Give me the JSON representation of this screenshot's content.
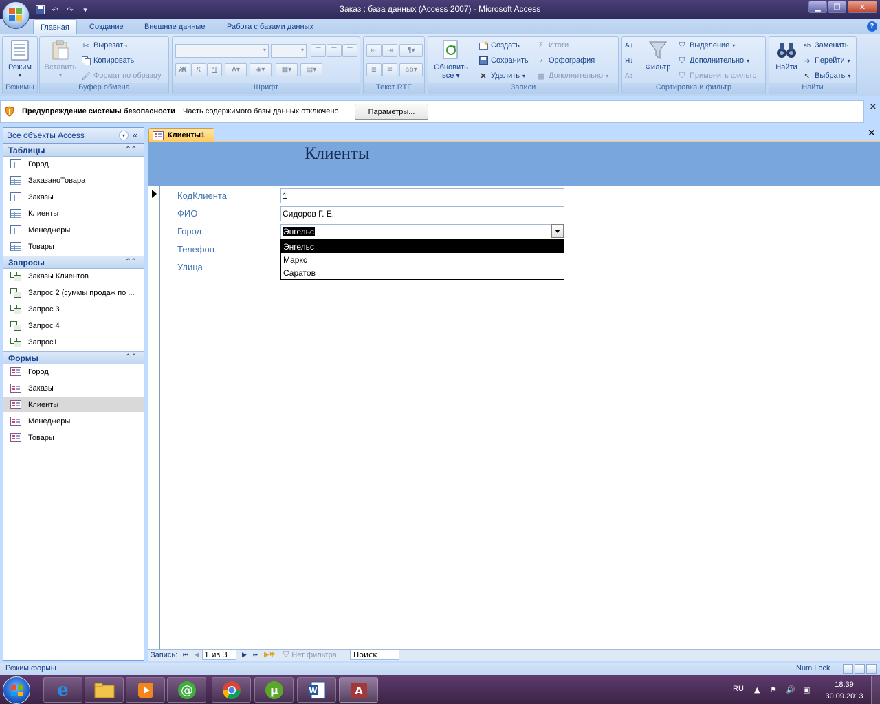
{
  "window": {
    "title": "Заказ : база данных (Access 2007)  -  Microsoft Access"
  },
  "ribbon_tabs": [
    "Главная",
    "Создание",
    "Внешние данные",
    "Работа с базами данных"
  ],
  "groups": {
    "modes": {
      "label": "Режимы",
      "view": "Режим"
    },
    "clipboard": {
      "label": "Буфер обмена",
      "paste": "Вставить",
      "cut": "Вырезать",
      "copy": "Копировать",
      "format_painter": "Формат по образцу"
    },
    "font": {
      "label": "Шрифт"
    },
    "rtf": {
      "label": "Текст RTF"
    },
    "records": {
      "label": "Записи",
      "refresh": "Обновить",
      "refresh2": "все",
      "new": "Создать",
      "save": "Сохранить",
      "delete": "Удалить",
      "totals": "Итоги",
      "spelling": "Орфография",
      "more": "Дополнительно"
    },
    "sort": {
      "label": "Сортировка и фильтр",
      "filter": "Фильтр",
      "selection": "Выделение",
      "advanced": "Дополнительно",
      "toggle": "Применить фильтр"
    },
    "find": {
      "label": "Найти",
      "find": "Найти",
      "replace": "Заменить",
      "goto": "Перейти",
      "select": "Выбрать"
    }
  },
  "security": {
    "title": "Предупреждение системы безопасности",
    "message": "Часть содержимого базы данных отключено",
    "button": "Параметры..."
  },
  "nav": {
    "header": "Все объекты Access",
    "sections": [
      {
        "title": "Таблицы",
        "items": [
          "Город",
          "ЗаказаноТовара",
          "Заказы",
          "Клиенты",
          "Менеджеры",
          "Товары"
        ]
      },
      {
        "title": "Запросы",
        "items": [
          "Заказы Клиентов",
          "Запрос 2 (суммы продаж по ...",
          "Запрос 3",
          "Запрос 4",
          "Запрос1"
        ]
      },
      {
        "title": "Формы",
        "items": [
          "Город",
          "Заказы",
          "Клиенты",
          "Менеджеры",
          "Товары"
        ]
      }
    ],
    "selected": "Клиенты"
  },
  "document": {
    "tab": "Клиенты1",
    "form_title": "Клиенты",
    "fields": [
      {
        "label": "КодКлиента",
        "value": "1"
      },
      {
        "label": "ФИО",
        "value": "Сидоров Г. Е."
      },
      {
        "label": "Город",
        "value": "Энгельс"
      },
      {
        "label": "Телефон",
        "value": ""
      },
      {
        "label": "Улица",
        "value": ""
      }
    ],
    "dropdown_options": [
      "Энгельс",
      "Маркс",
      "Саратов"
    ],
    "dropdown_highlighted": "Энгельс"
  },
  "record_nav": {
    "label": "Запись:",
    "position": "1 из 3",
    "filter": "Нет фильтра",
    "search": "Поиск"
  },
  "status": {
    "mode": "Режим формы",
    "numlock": "Num Lock"
  },
  "taskbar": {
    "lang": "RU",
    "time": "18:39",
    "date": "30.09.2013"
  }
}
